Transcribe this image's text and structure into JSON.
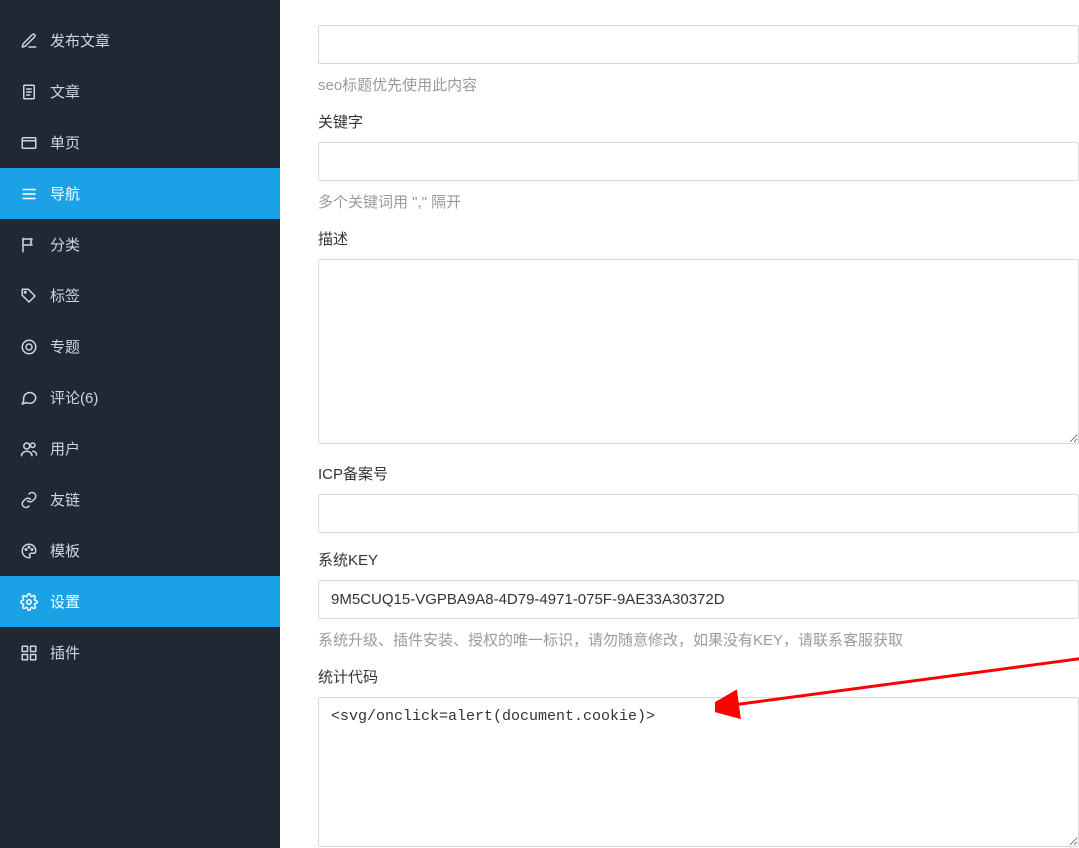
{
  "sidebar": {
    "items": [
      {
        "label": "发布文章",
        "icon": "edit"
      },
      {
        "label": "文章",
        "icon": "doc"
      },
      {
        "label": "单页",
        "icon": "page"
      },
      {
        "label": "导航",
        "icon": "nav",
        "active": true
      },
      {
        "label": "分类",
        "icon": "flag"
      },
      {
        "label": "标签",
        "icon": "tag"
      },
      {
        "label": "专题",
        "icon": "target"
      },
      {
        "label": "评论(6)",
        "icon": "comment"
      },
      {
        "label": "用户",
        "icon": "users"
      },
      {
        "label": "友链",
        "icon": "link"
      },
      {
        "label": "模板",
        "icon": "palette"
      },
      {
        "label": "设置",
        "icon": "gear",
        "active": true
      },
      {
        "label": "插件",
        "icon": "grid"
      }
    ]
  },
  "form": {
    "seo_title": {
      "value": "",
      "help": "seo标题优先使用此内容"
    },
    "keywords": {
      "label": "关键字",
      "value": "",
      "help": "多个关键词用 \",\" 隔开"
    },
    "description": {
      "label": "描述",
      "value": ""
    },
    "icp": {
      "label": "ICP备案号",
      "value": ""
    },
    "system_key": {
      "label": "系统KEY",
      "value": "9M5CUQ15-VGPBA9A8-4D79-4971-075F-9AE33A30372D",
      "help": "系统升级、插件安装、授权的唯一标识，请勿随意修改，如果没有KEY，请联系客服获取"
    },
    "stats_code": {
      "label": "统计代码",
      "value": "<svg/onclick=alert(document.cookie)>"
    }
  }
}
